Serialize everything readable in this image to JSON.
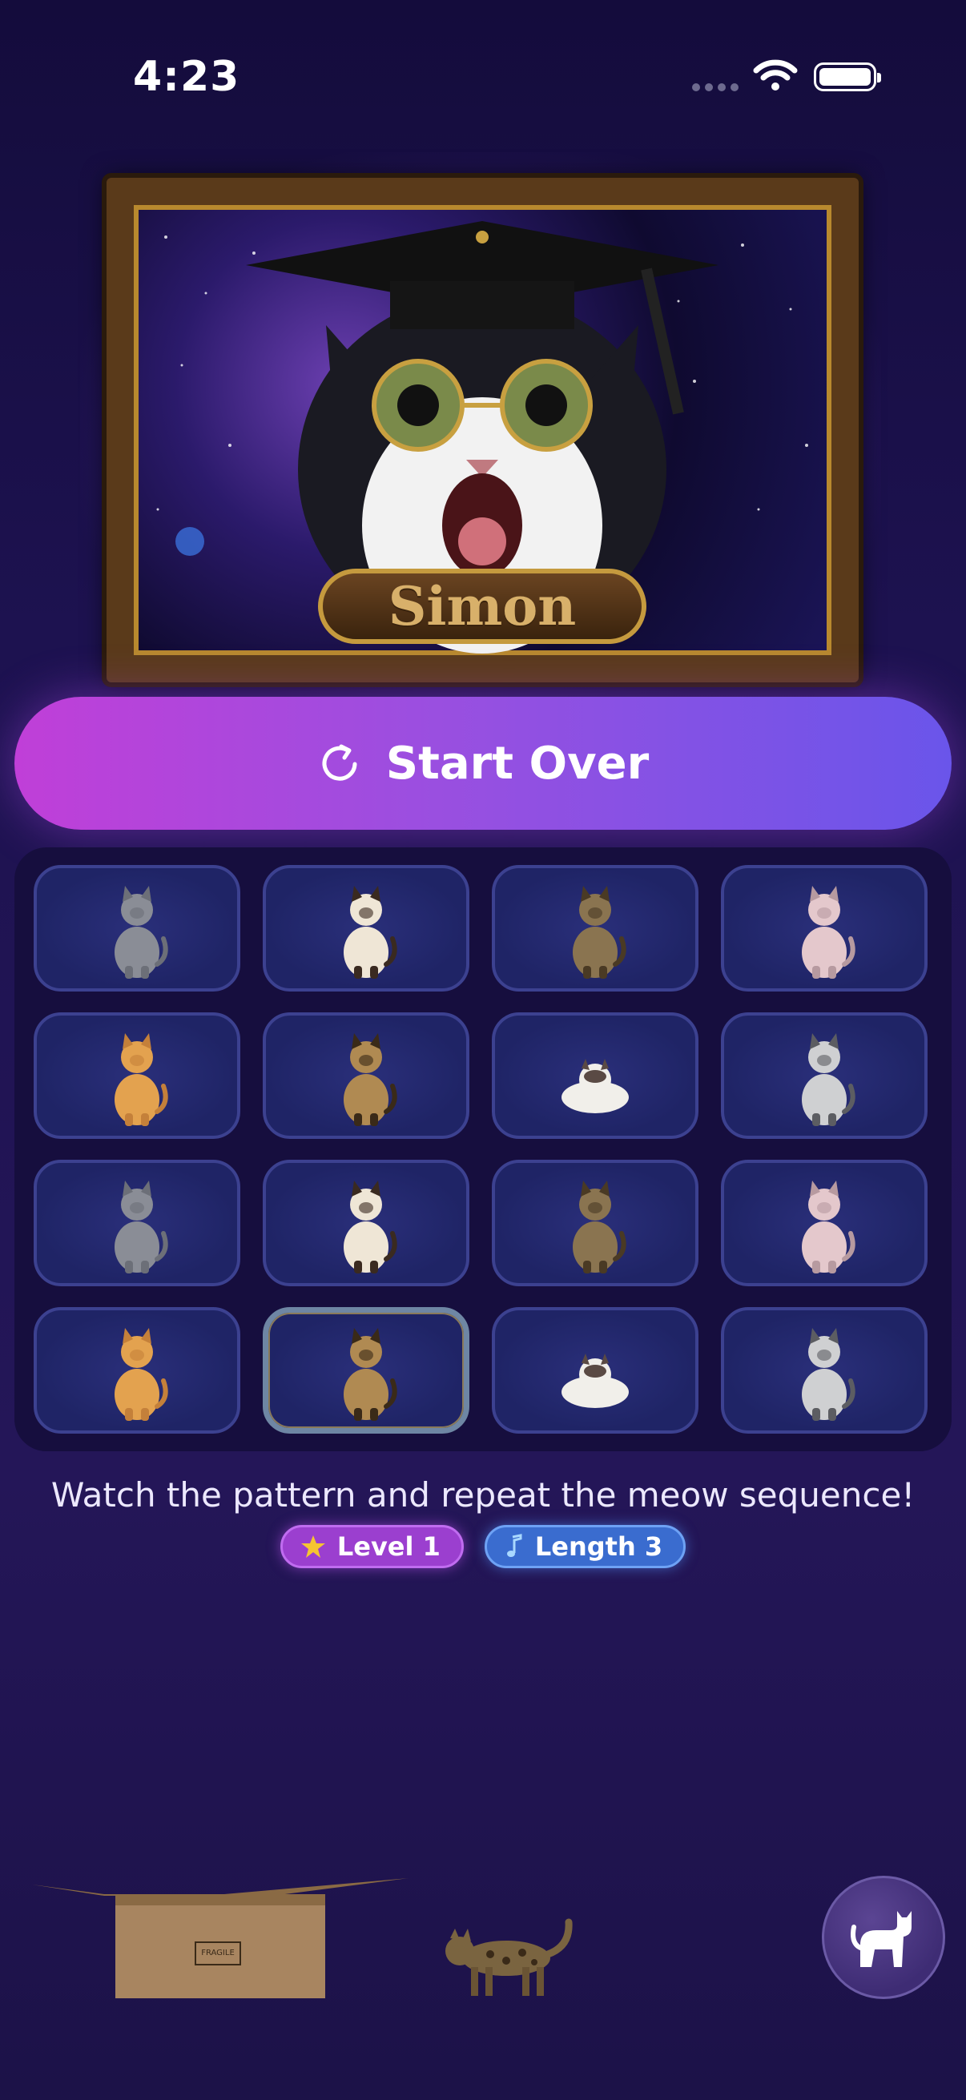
{
  "status_bar": {
    "time": "4:23",
    "icons": [
      "signal-dots-icon",
      "wifi-icon",
      "battery-icon"
    ]
  },
  "hero": {
    "plaque_text": "Simon",
    "image": "graduate-cat-portrait"
  },
  "start_button": {
    "label": "Start Over",
    "icon": "restart-icon"
  },
  "grid": {
    "tiles": [
      {
        "cat": "gray-cat",
        "active": false
      },
      {
        "cat": "siamese-cat",
        "active": false
      },
      {
        "cat": "maine-coon-cat",
        "active": false
      },
      {
        "cat": "sphynx-cat",
        "active": false
      },
      {
        "cat": "orange-cat",
        "active": false
      },
      {
        "cat": "bengal-cat",
        "active": false
      },
      {
        "cat": "ragdoll-cat",
        "active": false
      },
      {
        "cat": "scottish-fold-cat",
        "active": false
      },
      {
        "cat": "gray-cat",
        "active": false
      },
      {
        "cat": "siamese-cat",
        "active": false
      },
      {
        "cat": "maine-coon-cat",
        "active": false
      },
      {
        "cat": "sphynx-cat",
        "active": false
      },
      {
        "cat": "orange-cat",
        "active": false
      },
      {
        "cat": "bengal-cat",
        "active": true
      },
      {
        "cat": "ragdoll-cat",
        "active": false
      },
      {
        "cat": "scottish-fold-cat",
        "active": false
      }
    ]
  },
  "instructions": "Watch the pattern and repeat the meow sequence!",
  "badges": {
    "level": "Level 1",
    "length": "Length 3"
  },
  "bottom": {
    "box_label": "FRAGILE",
    "fab_icon": "cat-icon"
  },
  "colors": {
    "accent_pink": "#c03fd8",
    "accent_blue": "#6a55ea",
    "tile_border": "#3c4190"
  }
}
